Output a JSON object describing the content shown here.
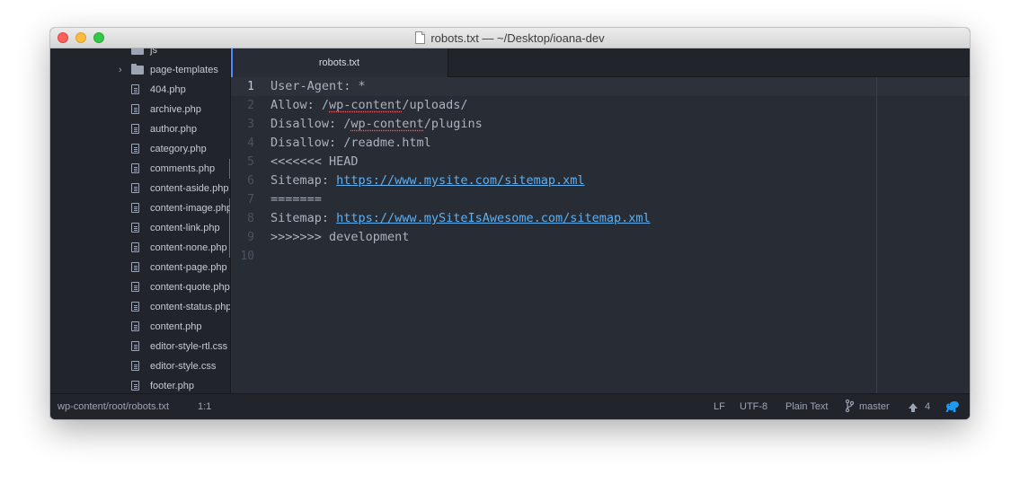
{
  "window": {
    "title": "robots.txt — ~/Desktop/ioana-dev"
  },
  "sidebar": {
    "items": [
      {
        "label": "js",
        "type": "folder",
        "expandable": false,
        "git": false
      },
      {
        "label": "page-templates",
        "type": "folder",
        "expandable": true,
        "git": false
      },
      {
        "label": "404.php",
        "type": "file",
        "git": false
      },
      {
        "label": "archive.php",
        "type": "file",
        "git": false
      },
      {
        "label": "author.php",
        "type": "file",
        "git": false
      },
      {
        "label": "category.php",
        "type": "file",
        "git": false
      },
      {
        "label": "comments.php",
        "type": "file",
        "git": true
      },
      {
        "label": "content-aside.php",
        "type": "file",
        "git": false
      },
      {
        "label": "content-image.php",
        "type": "file",
        "git": true
      },
      {
        "label": "content-link.php",
        "type": "file",
        "git": true
      },
      {
        "label": "content-none.php",
        "type": "file",
        "git": true
      },
      {
        "label": "content-page.php",
        "type": "file",
        "git": false
      },
      {
        "label": "content-quote.php",
        "type": "file",
        "git": false
      },
      {
        "label": "content-status.php",
        "type": "file",
        "git": false
      },
      {
        "label": "content.php",
        "type": "file",
        "git": false
      },
      {
        "label": "editor-style-rtl.css",
        "type": "file",
        "git": false
      },
      {
        "label": "editor-style.css",
        "type": "file",
        "git": false
      },
      {
        "label": "footer.php",
        "type": "file",
        "git": false
      }
    ]
  },
  "tabs": [
    {
      "label": "robots.txt",
      "active": true
    }
  ],
  "editor": {
    "lines": [
      {
        "num": "1",
        "parts": [
          {
            "t": "User-Agent: *"
          }
        ]
      },
      {
        "num": "2",
        "parts": [
          {
            "t": "Allow: /"
          },
          {
            "t": "wp-content",
            "style": "misspell"
          },
          {
            "t": "/uploads/"
          }
        ]
      },
      {
        "num": "3",
        "parts": [
          {
            "t": "Disallow: /"
          },
          {
            "t": "wp-content",
            "style": "misspell"
          },
          {
            "t": "/plugins"
          }
        ]
      },
      {
        "num": "4",
        "parts": [
          {
            "t": "Disallow: /readme.html"
          }
        ]
      },
      {
        "num": "5",
        "parts": [
          {
            "t": "<<<<<<< HEAD"
          }
        ]
      },
      {
        "num": "6",
        "parts": [
          {
            "t": "Sitemap: "
          },
          {
            "t": "https://www.mysite.com/sitemap.xml",
            "style": "link"
          }
        ]
      },
      {
        "num": "7",
        "parts": [
          {
            "t": "======="
          }
        ]
      },
      {
        "num": "8",
        "parts": [
          {
            "t": "Sitemap: "
          },
          {
            "t": "https://www.mySiteIsAwesome.com/sitemap.xml",
            "style": "link"
          }
        ]
      },
      {
        "num": "9",
        "parts": [
          {
            "t": ">>>>>>> development"
          }
        ]
      },
      {
        "num": "10",
        "parts": []
      }
    ],
    "active_line": 0
  },
  "status": {
    "path": "wp-content/root/robots.txt",
    "cursor": "1:1",
    "line_ending": "LF",
    "encoding": "UTF-8",
    "grammar": "Plain Text",
    "branch": "master",
    "ahead": "4"
  },
  "colors": {
    "accent": "#528bff",
    "link": "#61afef",
    "git_added": "#43d08a",
    "squirrel": "#1d9bf0"
  }
}
